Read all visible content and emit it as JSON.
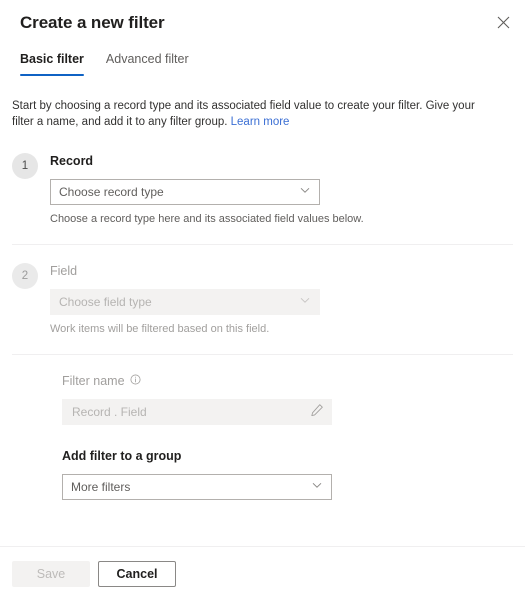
{
  "panel": {
    "title": "Create a new filter",
    "close_icon": "close-icon"
  },
  "tabs": [
    {
      "label": "Basic filter",
      "active": true
    },
    {
      "label": "Advanced filter",
      "active": false
    }
  ],
  "description": {
    "text": "Start by choosing a record type and its associated field value to create your filter. Give your filter a name, and add it to any filter group.",
    "link_label": "Learn more"
  },
  "steps": [
    {
      "number": "1",
      "label": "Record",
      "dropdown_value": "Choose record type",
      "hint": "Choose a record type here and its associated field values below.",
      "disabled": false
    },
    {
      "number": "2",
      "label": "Field",
      "dropdown_value": "Choose field type",
      "hint": "Work items will be filtered based on this field.",
      "disabled": true
    }
  ],
  "filter_name": {
    "label": "Filter name",
    "info_icon": "info-icon",
    "value": "Record . Field",
    "edit_icon": "pencil-icon"
  },
  "filter_group": {
    "label": "Add filter to a group",
    "dropdown_value": "More filters"
  },
  "footer": {
    "save_label": "Save",
    "cancel_label": "Cancel"
  },
  "colors": {
    "accent": "#0f62c4",
    "link": "#3b6fd4",
    "text_primary": "#201f1e",
    "text_secondary": "#605e5c",
    "text_disabled": "#a19f9d",
    "field_disabled_bg": "#f3f2f1",
    "divider": "#f0eff0",
    "badge_bg": "#e6e6e6"
  }
}
